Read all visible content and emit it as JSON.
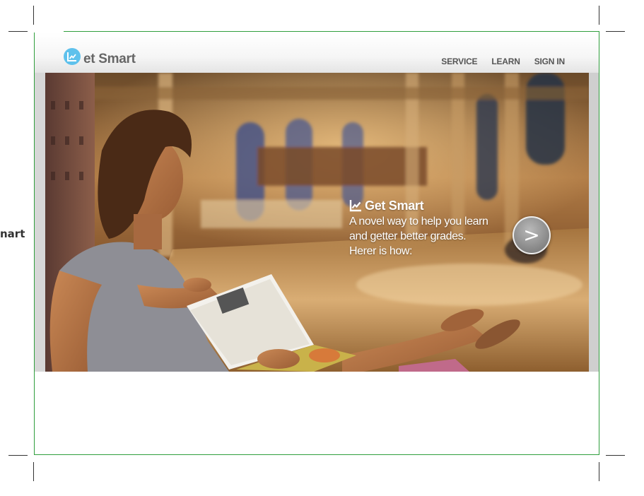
{
  "side_label": "nart",
  "header": {
    "logo_text": "et Smart",
    "nav": [
      "SERVICE",
      "LEARN",
      "SIGN IN"
    ]
  },
  "hero": {
    "title": "Get Smart",
    "lines": [
      "A novel way to help you learn",
      "and getter better grades.",
      "Herer is how:"
    ],
    "next_label": ">"
  },
  "colors": {
    "accent": "#5ec1ec",
    "frame": "#2f9e3c",
    "nav_text": "#555555"
  },
  "icons": [
    "chart-icon",
    "chevron-right-icon"
  ]
}
